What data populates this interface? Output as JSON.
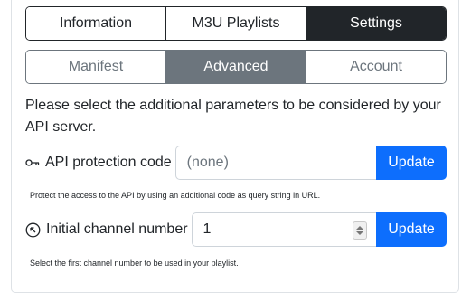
{
  "main_tabs": [
    {
      "label": "Information",
      "active": false
    },
    {
      "label": "M3U Playlists",
      "active": false
    },
    {
      "label": "Settings",
      "active": true
    }
  ],
  "sub_tabs": [
    {
      "label": "Manifest",
      "active": false
    },
    {
      "label": "Advanced",
      "active": true
    },
    {
      "label": "Account",
      "active": false
    }
  ],
  "intro_text": "Please select the additional parameters to be considered by your API server.",
  "api_protection": {
    "icon": "key-icon",
    "label": "API protection code",
    "value": "",
    "placeholder": "(none)",
    "button_label": "Update",
    "help": "Protect the access to the API by using an additional code as query string in URL."
  },
  "initial_channel": {
    "icon": "arrow-up-left-circle-icon",
    "label": "Initial channel number",
    "value": "1",
    "button_label": "Update",
    "help": "Select the first channel number to be used in your playlist."
  },
  "colors": {
    "primary": "#0d6efd",
    "dark": "#212529",
    "secondary": "#6c757d"
  }
}
